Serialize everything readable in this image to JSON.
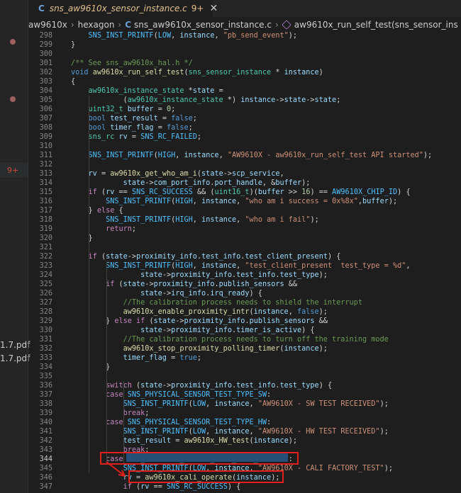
{
  "sidebar": {
    "badge": "9+",
    "files": [
      "1.7.pdf",
      "1.7.pdf"
    ]
  },
  "tab": {
    "lang_icon": "C",
    "name": "sns_aw9610x_sensor_instance.c",
    "modified": "9+",
    "close_icon": "close-icon"
  },
  "breadcrumb": {
    "items": [
      "aw9610x",
      "hexagon"
    ],
    "file_icon": "C",
    "file": "sns_aw9610x_sensor_instance.c",
    "symbol_icon": "cube-icon",
    "symbol": "aw9610x_run_self_test(sns_sensor_ins"
  },
  "editor": {
    "current_line": 344,
    "highlight_color": "#e0201a",
    "lines": [
      {
        "n": "298",
        "t": "        SNS_INST_PRINTF(LOW, instance, \"pb_send_event\");"
      },
      {
        "n": "299",
        "t": "    }"
      },
      {
        "n": "300",
        "t": ""
      },
      {
        "n": "301",
        "t": "    /** See sns_aw9610x_hal.h */"
      },
      {
        "n": "302",
        "t": "    void aw9610x_run_self_test(sns_sensor_instance * instance)"
      },
      {
        "n": "303",
        "t": "    {"
      },
      {
        "n": "304",
        "t": "        aw9610x_instance_state *state ="
      },
      {
        "n": "305",
        "t": "                (aw9610x_instance_state *) instance->state->state;"
      },
      {
        "n": "306",
        "t": "        uint32_t buffer = 0;"
      },
      {
        "n": "307",
        "t": "        bool test_result = false;"
      },
      {
        "n": "308",
        "t": "        bool timer_flag = false;"
      },
      {
        "n": "309",
        "t": "        sns_rc rv = SNS_RC_FAILED;"
      },
      {
        "n": "310",
        "t": ""
      },
      {
        "n": "311",
        "t": "        SNS_INST_PRINTF(HIGH, instance, \"AW9610X - aw9610x_run_self_test API started\");"
      },
      {
        "n": "312",
        "t": ""
      },
      {
        "n": "313",
        "t": "        rv = aw9610x_get_who_am_i(state->scp_service,"
      },
      {
        "n": "314",
        "t": "                state->com_port_info.port_handle, &buffer);"
      },
      {
        "n": "315",
        "t": "        if (rv == SNS_RC_SUCCESS && (uint16_t)(buffer >> 16) == AW9610X_CHIP_ID) {"
      },
      {
        "n": "316",
        "t": "            SNS_INST_PRINTF(HIGH, instance, \"who am i success = 0x%8x\",buffer);"
      },
      {
        "n": "317",
        "t": "        } else {"
      },
      {
        "n": "318",
        "t": "            SNS_INST_PRINTF(HIGH, instance, \"who am i fail\");"
      },
      {
        "n": "319",
        "t": "            return;"
      },
      {
        "n": "320",
        "t": "        }"
      },
      {
        "n": "321",
        "t": ""
      },
      {
        "n": "322",
        "t": "        if (state->proximity_info.test_info.test_client_present) {"
      },
      {
        "n": "323",
        "t": "            SNS_INST_PRINTF(HIGH, instance, \"test_client_present  test_type = %d\","
      },
      {
        "n": "324",
        "t": "                    state->proximity_info.test_info.test_type);"
      },
      {
        "n": "325",
        "t": "            if (state->proximity_info.publish_sensors &&"
      },
      {
        "n": "326",
        "t": "                    state->irq_info.irq_ready) {"
      },
      {
        "n": "327",
        "t": "                //The calibration process needs to shield the interrupt"
      },
      {
        "n": "328",
        "t": "                aw9610x_enable_proximity_intr(instance, false);"
      },
      {
        "n": "329",
        "t": "            } else if (state->proximity_info.publish_sensors &&"
      },
      {
        "n": "330",
        "t": "                    state->proximity_info.timer_is_active) {"
      },
      {
        "n": "331",
        "t": "                //The calibration process needs to turn off the training mode"
      },
      {
        "n": "332",
        "t": "                aw9610x_stop_proximity_polling_timer(instance);"
      },
      {
        "n": "333",
        "t": "                timer_flag = true;"
      },
      {
        "n": "334",
        "t": "            }"
      },
      {
        "n": "335",
        "t": ""
      },
      {
        "n": "336",
        "t": "            switch (state->proximity_info.test_info.test_type) {"
      },
      {
        "n": "337",
        "t": "            case SNS_PHYSICAL_SENSOR_TEST_TYPE_SW:"
      },
      {
        "n": "338",
        "t": "                SNS_INST_PRINTF(LOW, instance, \"AW9610X - SW TEST RECEIVED\");"
      },
      {
        "n": "339",
        "t": "                break;"
      },
      {
        "n": "340",
        "t": "            case SNS_PHYSICAL_SENSOR_TEST_TYPE_HW:"
      },
      {
        "n": "341",
        "t": "                SNS_INST_PRINTF(LOW, instance, \"AW9610X - HW TEST RECEIVED\");"
      },
      {
        "n": "342",
        "t": "                test_result = aw9610x_HW_test(instance);"
      },
      {
        "n": "343",
        "t": "                break;"
      },
      {
        "n": "344",
        "t": "            case SNS_PHYSICAL_SENSOR_TEST_TYPE_FACTORY:"
      },
      {
        "n": "345",
        "t": "                SNS_INST_PRINTF(LOW, instance, \"AW9610X - CALI FACTORY_TEST\");"
      },
      {
        "n": "346",
        "t": "                rv = aw9610x_cali_operate(instance);"
      },
      {
        "n": "347",
        "t": "                if (rv == SNS_RC_SUCCESS) {"
      }
    ]
  }
}
